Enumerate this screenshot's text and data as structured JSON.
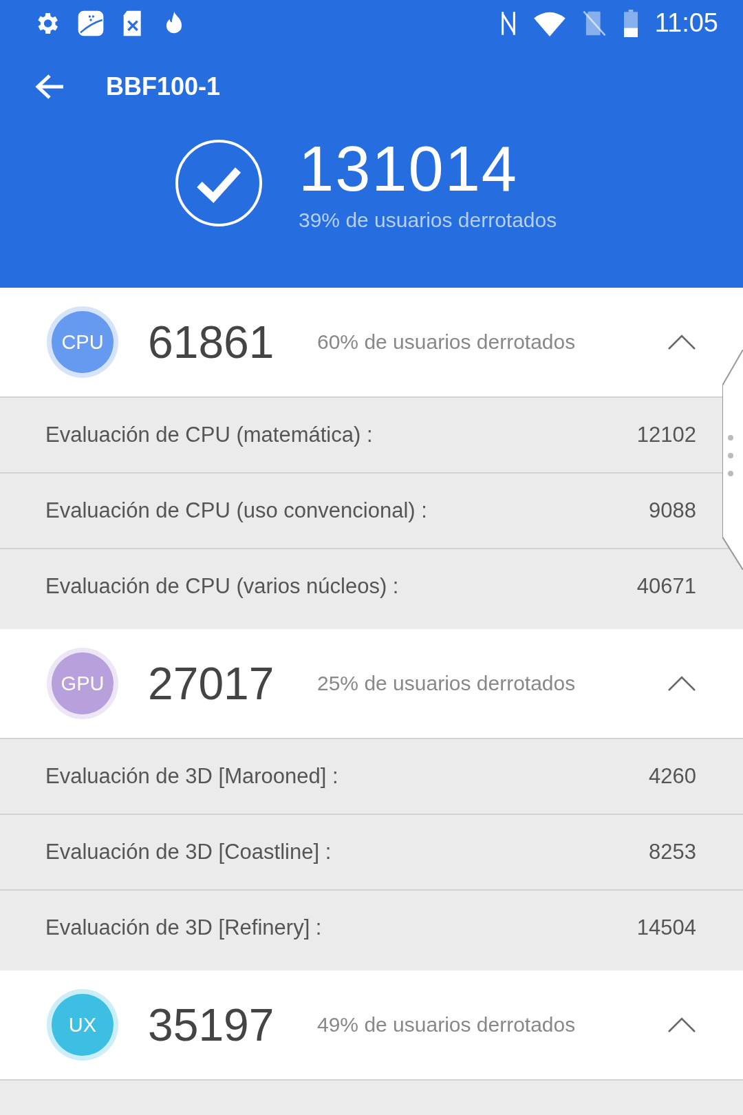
{
  "status_bar": {
    "time": "11:05"
  },
  "toolbar": {
    "title": "BBF100-1"
  },
  "total": {
    "score": "131014",
    "beaten": "39% de usuarios derrotados"
  },
  "sections": [
    {
      "badge": "CPU",
      "color": "#6699f0",
      "score": "61861",
      "beaten": "60% de usuarios derrotados",
      "expanded": true,
      "rows": [
        {
          "label": "Evaluación de CPU (matemática) :",
          "value": "12102"
        },
        {
          "label": "Evaluación de CPU (uso convencional) :",
          "value": "9088"
        },
        {
          "label": "Evaluación de CPU (varios núcleos) :",
          "value": "40671"
        }
      ]
    },
    {
      "badge": "GPU",
      "color": "#b7a0dc",
      "score": "27017",
      "beaten": "25% de usuarios derrotados",
      "expanded": true,
      "rows": [
        {
          "label": "Evaluación de 3D [Marooned] :",
          "value": "4260"
        },
        {
          "label": "Evaluación de 3D [Coastline] :",
          "value": "8253"
        },
        {
          "label": "Evaluación de 3D [Refinery] :",
          "value": "14504"
        }
      ]
    },
    {
      "badge": "UX",
      "color": "#3cbfe3",
      "score": "35197",
      "beaten": "49% de usuarios derrotados",
      "expanded": true
    }
  ]
}
